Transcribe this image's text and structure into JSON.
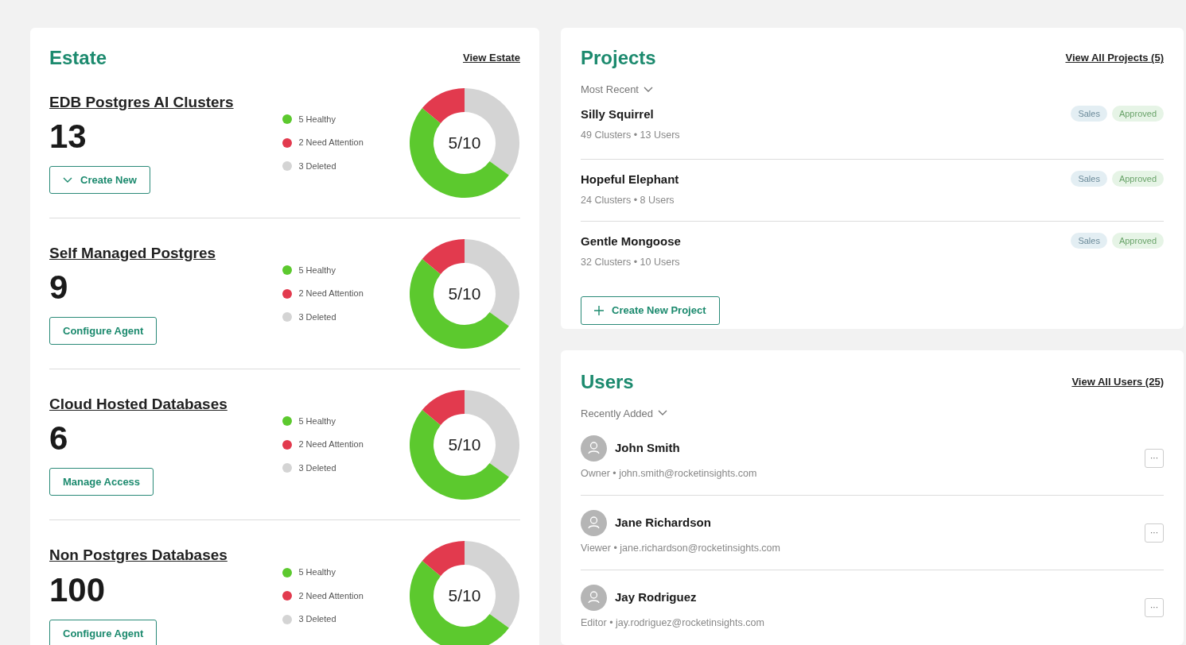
{
  "estate": {
    "title": "Estate",
    "link": "View Estate",
    "sections": [
      {
        "title": "EDB Postgres AI Clusters",
        "count": "13",
        "button": {
          "label": "Create New",
          "kind": "dropdown"
        },
        "legend": [
          {
            "label": "5 Healthy",
            "color": "#5cc92e"
          },
          {
            "label": "2 Need Attention",
            "color": "#e23a4e"
          },
          {
            "label": "3 Deleted",
            "color": "#d4d4d4"
          }
        ],
        "center": "5/10"
      },
      {
        "title": "Self Managed Postgres",
        "count": "9",
        "button": {
          "label": "Configure Agent",
          "kind": "plain"
        },
        "legend": [
          {
            "label": "5 Healthy",
            "color": "#5cc92e"
          },
          {
            "label": "2 Need Attention",
            "color": "#e23a4e"
          },
          {
            "label": "3 Deleted",
            "color": "#d4d4d4"
          }
        ],
        "center": "5/10"
      },
      {
        "title": "Cloud Hosted Databases",
        "count": "6",
        "button": {
          "label": "Manage Access",
          "kind": "plain"
        },
        "legend": [
          {
            "label": "5 Healthy",
            "color": "#5cc92e"
          },
          {
            "label": "2 Need Attention",
            "color": "#e23a4e"
          },
          {
            "label": "3 Deleted",
            "color": "#d4d4d4"
          }
        ],
        "center": "5/10"
      },
      {
        "title": "Non Postgres Databases",
        "count": "100",
        "button": {
          "label": "Configure Agent",
          "kind": "plain"
        },
        "legend": [
          {
            "label": "5 Healthy",
            "color": "#5cc92e"
          },
          {
            "label": "2 Need Attention",
            "color": "#e23a4e"
          },
          {
            "label": "3 Deleted",
            "color": "#d4d4d4"
          }
        ],
        "center": "5/10"
      }
    ]
  },
  "projects": {
    "title": "Projects",
    "link": "View All Projects (5)",
    "sort": "Most Recent",
    "items": [
      {
        "name": "Silly Squirrel",
        "meta": "49 Clusters • 13 Users",
        "tags": [
          {
            "label": "Sales",
            "color": "#e3eef3"
          },
          {
            "label": "Approved",
            "color": "#e6f4e6"
          }
        ]
      },
      {
        "name": "Hopeful Elephant",
        "meta": "24 Clusters • 8 Users",
        "tags": [
          {
            "label": "Sales",
            "color": "#e3eef3"
          },
          {
            "label": "Approved",
            "color": "#e6f4e6"
          }
        ]
      },
      {
        "name": "Gentle Mongoose",
        "meta": "32 Clusters • 10 Users",
        "tags": [
          {
            "label": "Sales",
            "color": "#e3eef3"
          },
          {
            "label": "Approved",
            "color": "#e6f4e6"
          }
        ]
      }
    ],
    "button": "Create New Project"
  },
  "users": {
    "title": "Users",
    "link": "View All Users (25)",
    "sort": "Recently Added",
    "items": [
      {
        "name": "John Smith",
        "meta": "Owner • john.smith@rocketinsights.com",
        "menu": "···"
      },
      {
        "name": "Jane Richardson",
        "meta": "Viewer • jane.richardson@rocketinsights.com",
        "menu": "···"
      },
      {
        "name": "Jay Rodriguez",
        "meta": "Editor • jay.rodriguez@rocketinsights.com",
        "menu": "···"
      }
    ]
  }
}
